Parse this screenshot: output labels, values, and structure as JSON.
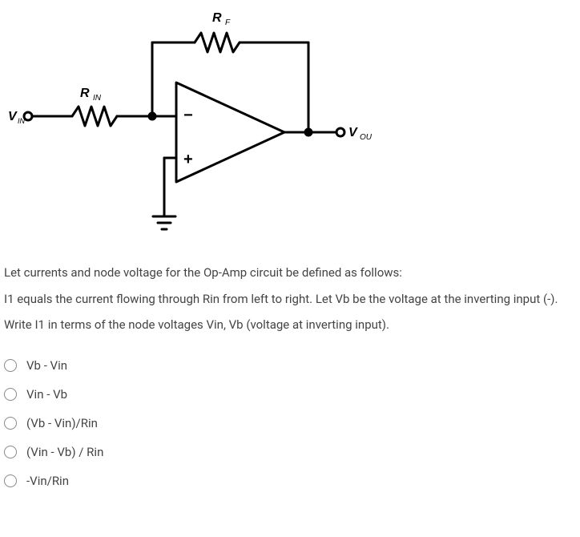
{
  "circuit": {
    "labels": {
      "Rf": "R",
      "Rf_sub": "F",
      "Rin": "R",
      "Rin_sub": "IN",
      "Vin": "V",
      "Vin_sub": "IN",
      "Vout": "V",
      "Vout_sub": "OUT",
      "minus": "−",
      "plus": "+"
    }
  },
  "question": {
    "p1": "Let currents and node voltage for the Op-Amp circuit be defined as follows:",
    "p2": "I1 equals the current flowing through Rin from left to right.   Let Vb be the voltage at the inverting input (-).",
    "p3": "Write  I1 in terms of the node voltages  Vin,  Vb (voltage at inverting input)."
  },
  "options": [
    {
      "label": "Vb - Vin"
    },
    {
      "label": "Vin - Vb"
    },
    {
      "label": "(Vb - Vin)/Rin"
    },
    {
      "label": "(Vin - Vb) / Rin"
    },
    {
      "label": "-Vin/Rin"
    }
  ]
}
